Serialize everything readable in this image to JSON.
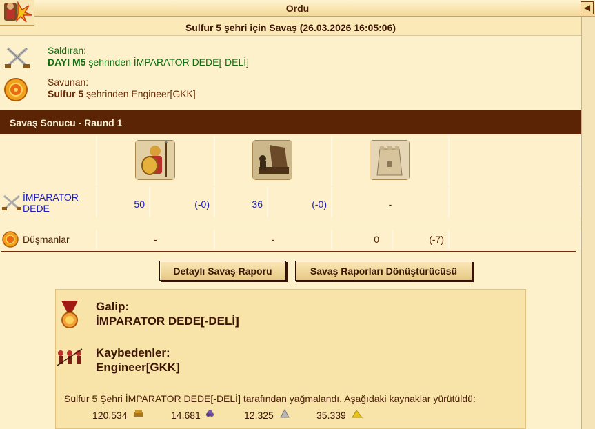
{
  "window": {
    "title": "Ordu",
    "back_icon": "◀"
  },
  "battle": {
    "title": "Sulfur 5 şehri için Savaş (26.03.2026 16:05:06)",
    "attacker": {
      "label": "Saldıran:",
      "city": "DAYI M5",
      "text": " şehrinden İMPARATOR DEDE[-DELİ]"
    },
    "defender": {
      "label": "Savunan:",
      "city": "Sulfur 5",
      "text": " şehrinden Engineer[GKK]"
    }
  },
  "result_header": "Savaş Sonucu - Raund 1",
  "units": [
    "hoplite",
    "catapult",
    "wall"
  ],
  "rows": [
    {
      "name": "İMPARATOR DEDE",
      "cells": [
        {
          "count": "50",
          "loss": "(-0)"
        },
        {
          "count": "36",
          "loss": "(-0)"
        },
        {
          "count": "-",
          "loss": ""
        }
      ]
    },
    {
      "name": "Düşmanlar",
      "cells": [
        {
          "count": "-",
          "loss": ""
        },
        {
          "count": "-",
          "loss": ""
        },
        {
          "count": "0",
          "loss": "(-7)"
        }
      ]
    }
  ],
  "buttons": {
    "detailed": "Detaylı Savaş Raporu",
    "converter": "Savaş Raporları Dönüştürücüsü"
  },
  "outcome": {
    "winner_label": "Galip:",
    "winner": "İMPARATOR DEDE[-DELİ]",
    "loser_label": "Kaybedenler:",
    "loser": "Engineer[GKK]",
    "loot_text": "Sulfur 5 Şehri İMPARATOR DEDE[-DELİ] tarafından yağmalandı. Aşağıdaki kaynaklar yürütüldü:",
    "resources": [
      {
        "icon": "wood-icon",
        "value": "120.534"
      },
      {
        "icon": "wine-icon",
        "value": "14.681"
      },
      {
        "icon": "marble-icon",
        "value": "12.325"
      },
      {
        "icon": "sulfur-icon",
        "value": "35.339"
      }
    ]
  }
}
